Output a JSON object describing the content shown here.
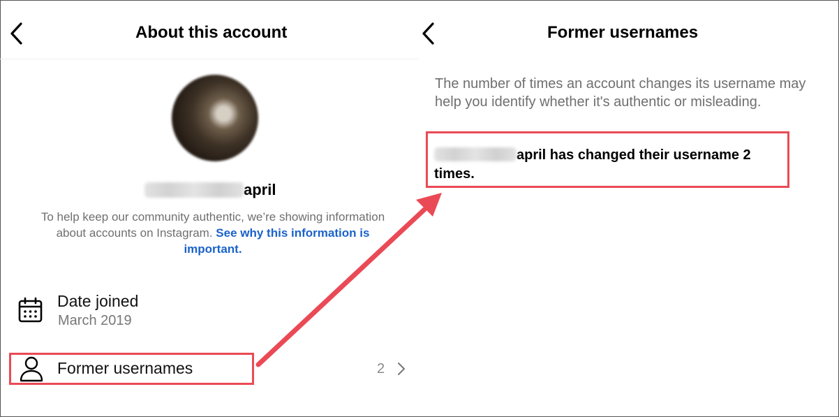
{
  "left_screen": {
    "title": "About this account",
    "username_suffix": "april",
    "info_text": "To help keep our community authentic, we’re showing information about accounts on Instagram. ",
    "info_link": "See why this information is important.",
    "date_joined": {
      "label": "Date joined",
      "value": "March 2019",
      "icon": "calendar-icon"
    },
    "former_usernames": {
      "label": "Former usernames",
      "count": "2",
      "icon": "person-icon"
    }
  },
  "right_screen": {
    "title": "Former usernames",
    "description": "The number of times an account changes its username may help you identify whether it's authentic or misleading.",
    "change_text_suffix": "april has changed their username 2 times."
  },
  "annotation": {
    "color": "#ea4a55",
    "link_color": "#1a62c9"
  }
}
